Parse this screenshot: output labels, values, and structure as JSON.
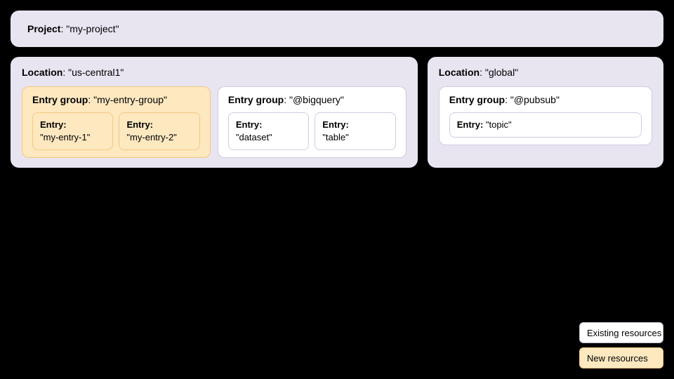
{
  "project": {
    "label": "Project",
    "value": "\"my-project\""
  },
  "locations": [
    {
      "id": "us-central1",
      "label": "Location",
      "value": "\"us-central1\"",
      "type": "existing",
      "entryGroups": [
        {
          "id": "my-entry-group",
          "label": "Entry group",
          "value": "\"my-entry-group\"",
          "type": "new",
          "entries": [
            {
              "label": "Entry",
              "value": "\"my-entry-1\"",
              "type": "new"
            },
            {
              "label": "Entry",
              "value": "\"my-entry-2\"",
              "type": "new"
            }
          ]
        },
        {
          "id": "bigquery",
          "label": "Entry group",
          "value": "\"@bigquery\"",
          "type": "existing",
          "entries": [
            {
              "label": "Entry",
              "value": "\"dataset\"",
              "type": "existing"
            },
            {
              "label": "Entry",
              "value": "\"table\"",
              "type": "existing"
            }
          ]
        }
      ]
    },
    {
      "id": "global",
      "label": "Location",
      "value": "\"global\"",
      "type": "existing",
      "entryGroups": [
        {
          "id": "pubsub",
          "label": "Entry group",
          "value": "\"@pubsub\"",
          "type": "existing",
          "entries": [
            {
              "label": "Entry",
              "value": "\"topic\"",
              "type": "existing"
            }
          ]
        }
      ]
    }
  ],
  "legend": {
    "existing": "Existing resources",
    "new": "New resources"
  }
}
